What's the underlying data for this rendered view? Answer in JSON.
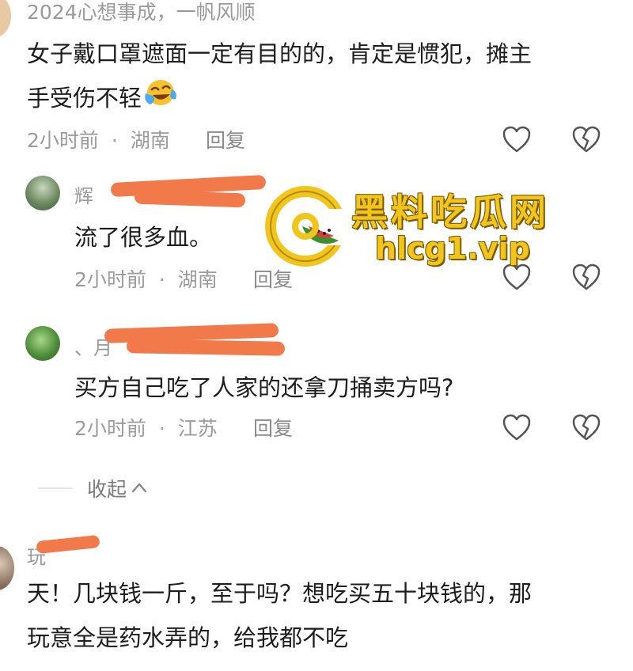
{
  "comments": [
    {
      "username": "2024心想事成，一帆风顺",
      "lines": [
        "女子戴口罩遮面一定有目的的，肯定是惯犯，摊主",
        "手受伤不轻"
      ],
      "emoji": "laughing-crying",
      "time": "2小时前",
      "location": "湖南",
      "reply": "回复"
    },
    {
      "username": "辉",
      "lines": [
        "流了很多血。"
      ],
      "time": "2小时前",
      "location": "湖南",
      "reply": "回复"
    },
    {
      "username": "、月",
      "lines": [
        "买方自己吃了人家的还拿刀捅卖方吗?"
      ],
      "time": "2小时前",
      "location": "江苏",
      "reply": "回复"
    },
    {
      "username": "玩",
      "lines": [
        "天！几块钱一斤，至于吗？想吃买五十块钱的，那",
        "玩意全是药水弄的，给我都不吃"
      ]
    }
  ],
  "meta_separator": "·",
  "collapse": {
    "label": "收起"
  },
  "watermark": {
    "title": "黑料吃瓜网",
    "url": "hlcg1.vip"
  },
  "colors": {
    "redaction": "#f27a4a",
    "watermark": "#f2c51c",
    "meta_text": "#9b9b9b"
  },
  "icons": [
    "like-heart-icon",
    "dislike-broken-heart-icon",
    "chevron-up-icon"
  ]
}
